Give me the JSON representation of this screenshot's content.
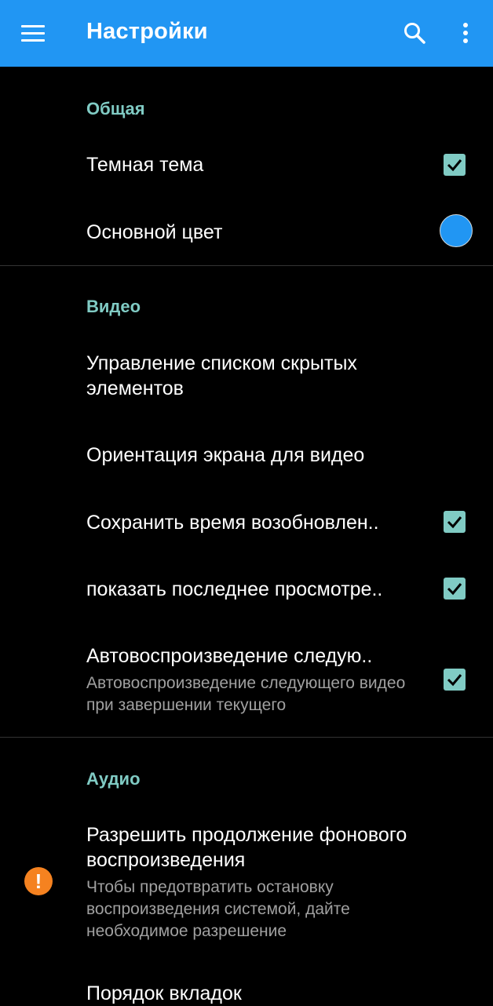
{
  "app_bar": {
    "title": "Настройки",
    "background": "#2196f3",
    "icons": [
      "menu-icon",
      "search-icon",
      "more-vert-icon"
    ]
  },
  "accent_color": "#80cbc4",
  "sections": {
    "general": {
      "title": "Общая",
      "dark_theme": {
        "title": "Темная тема",
        "checked": true
      },
      "primary_color": {
        "title": "Основной цвет",
        "color": "#2196f3"
      }
    },
    "video": {
      "title": "Видео",
      "hidden_items": {
        "title": "Управление списком скрытых элементов"
      },
      "orientation": {
        "title": "Ориентация экрана для видео"
      },
      "save_resume": {
        "title": "Сохранить время возобновлен..",
        "checked": true
      },
      "show_last_watched": {
        "title": "показать последнее просмотре..",
        "checked": true
      },
      "autoplay_next": {
        "title": "Автовоспроизведение следую..",
        "summary": "Автовоспроизведение следующего видео при завершении текущего",
        "checked": true
      }
    },
    "audio": {
      "title": "Аудио",
      "background_playback": {
        "title": "Разрешить продолжение фонового воспроизведения",
        "summary": "Чтобы предотвратить остановку воспроизведения системой, дайте необходимое разрешение",
        "icon": "warning-icon",
        "icon_glyph": "!"
      },
      "tab_order": {
        "title": "Порядок вкладок"
      }
    }
  }
}
